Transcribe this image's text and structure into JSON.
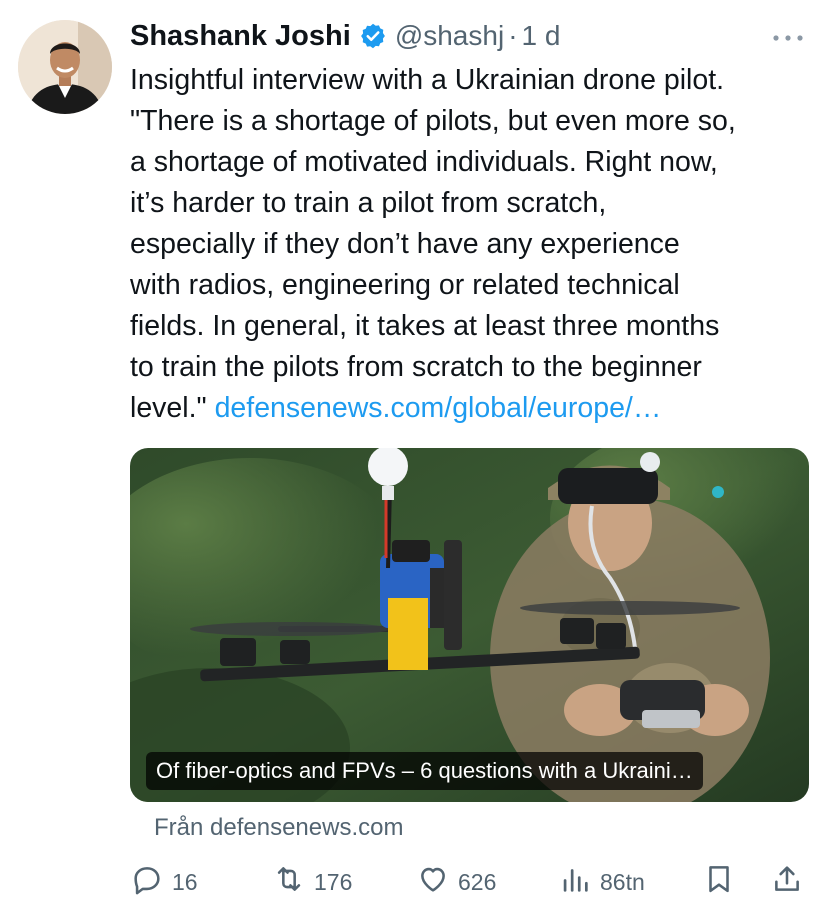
{
  "author": {
    "name": "Shashank Joshi",
    "handle": "@shashj",
    "separator": "·",
    "time": "1 d",
    "verified": true
  },
  "tweet": {
    "lines": [
      "Insightful interview with a Ukrainian drone pilot.",
      "\"There is a shortage of pilots, but even more so,",
      "a shortage of motivated individuals. Right now,",
      "it’s harder to train a pilot from scratch,",
      "especially if they don’t have any experience",
      "with radios, engineering or related technical",
      "fields. In general, it takes at least three months",
      "to train the pilots from scratch to the beginner"
    ],
    "last_line_prefix": "level.\" ",
    "link_text": "defensenews.com/global/europe/…"
  },
  "card": {
    "caption": "Of fiber-optics and FPVs – 6 questions with a Ukraini…",
    "source": "Från defensenews.com"
  },
  "actions": {
    "replies": "16",
    "retweets": "176",
    "likes": "626",
    "views": "86tn"
  },
  "icons": {
    "verified": "verified-badge-icon",
    "more": "more-options-icon",
    "reply": "reply-icon",
    "retweet": "retweet-icon",
    "like": "heart-icon",
    "views": "views-chart-icon",
    "bookmark": "bookmark-icon",
    "share": "share-icon"
  },
  "colors": {
    "link": "#1d9bf0",
    "verified": "#1d9bf0",
    "muted": "#536471",
    "text": "#0f1419"
  }
}
